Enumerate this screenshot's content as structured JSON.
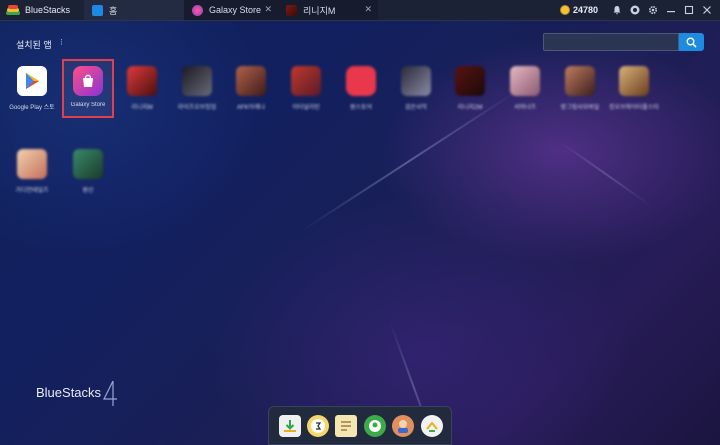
{
  "titlebar": {
    "app_name": "BlueStacks",
    "tabs": [
      {
        "label": "홈",
        "close": ""
      },
      {
        "label": "Galaxy Store",
        "close": "✕"
      },
      {
        "label": "리니지M",
        "close": "✕"
      }
    ],
    "coins": "24780"
  },
  "home": {
    "section_label": "설치된 앱",
    "section_more": "⁝",
    "search_placeholder": ""
  },
  "apps": [
    {
      "label": "Google Play 스토",
      "icon": "google-play-icon"
    },
    {
      "label": "Galaxy Store",
      "icon": "galaxy-store-icon",
      "selected": true
    },
    {
      "label": "리니지M",
      "icon": "game-icon"
    },
    {
      "label": "라이즈오브킹덤",
      "icon": "game-icon"
    },
    {
      "label": "AFK아레나",
      "icon": "game-icon"
    },
    {
      "label": "이터널리턴",
      "icon": "game-icon"
    },
    {
      "label": "원스토어",
      "icon": "onestore-icon"
    },
    {
      "label": "검은사막",
      "icon": "game-icon"
    },
    {
      "label": "리니지2M",
      "icon": "game-icon"
    },
    {
      "label": "서머너즈",
      "icon": "game-icon"
    },
    {
      "label": "랑그릿사모바일",
      "icon": "game-icon"
    },
    {
      "label": "킹오브파이터올스타",
      "icon": "game-icon"
    },
    {
      "label": "가디언테일즈",
      "icon": "game-icon"
    },
    {
      "label": "원신",
      "icon": "game-icon"
    }
  ],
  "brand": {
    "text": "BlueStacks",
    "version": "4"
  },
  "colors": {
    "accent": "#1c8be0",
    "selection": "#e0404a",
    "coin": "#f3c23a"
  }
}
